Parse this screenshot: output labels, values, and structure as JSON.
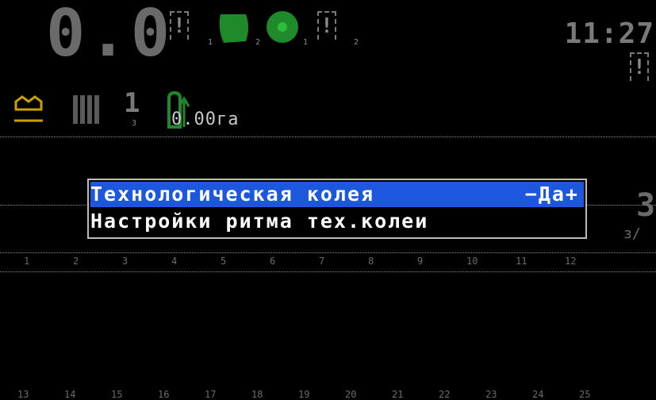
{
  "header": {
    "speed": "0.0",
    "clock": "11:27",
    "warn1_sub": "1",
    "green1_sub": "2",
    "green2_sub": "1",
    "warn2_sub": "2",
    "tramline_count": "1",
    "tramline_sub": "3",
    "area": "0.00га"
  },
  "right_panel": {
    "value": "3",
    "sub": "з/"
  },
  "menu": {
    "items": [
      {
        "label": "Технологическая колея",
        "value": "−Да+"
      },
      {
        "label": "Настройки ритма тех.колеи"
      }
    ]
  },
  "rows": {
    "top": [
      "1",
      "2",
      "3",
      "4",
      "5",
      "6",
      "7",
      "8",
      "9",
      "10",
      "11",
      "12"
    ],
    "bottom": [
      "13",
      "14",
      "15",
      "16",
      "17",
      "18",
      "19",
      "20",
      "21",
      "22",
      "23",
      "24",
      "25"
    ]
  },
  "colors": {
    "highlight": "#1c57dd",
    "green": "#1e8a2a",
    "yellow": "#c8a000"
  }
}
